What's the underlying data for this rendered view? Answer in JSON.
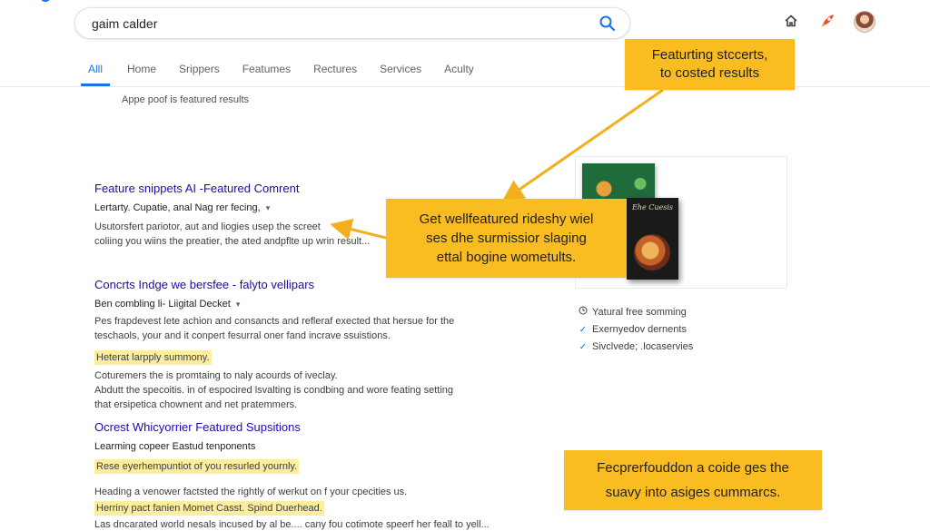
{
  "search": {
    "value": "gaim calder"
  },
  "tabs": [
    {
      "label": "Alll",
      "active": true
    },
    {
      "label": "Home"
    },
    {
      "label": "Srippers"
    },
    {
      "label": "Featumes"
    },
    {
      "label": "Rectures"
    },
    {
      "label": "Services"
    },
    {
      "label": "Aculty"
    }
  ],
  "result_stats": "Appe poof is featured results",
  "results": [
    {
      "title": "Feature snippets AI -Featured Comrent",
      "meta": "Lertarty. Cupatie, anal Nag rer fecing,",
      "snippet_lines": [
        "Usutorsfert pariotor, aut and liogies usep the screet",
        "coliing you wiins the preatier, the ated andpflte up wrin result..."
      ]
    },
    {
      "title": "Concrts Indge we bersfee - falyto vellipars",
      "meta": "Ben combling li- Liigital Decket",
      "snippet_lines": [
        "Pes frapdevest lete achion and consancts and refleraf exected that hersue for the",
        "teschaols, your and it conpert fesurral oner fand incrave ssuistions."
      ],
      "highlight_1": "Heterat larpply summony.",
      "snippet_lines_2": [
        "Coturemers the is promtaing to naly acourds of iveclay.",
        "Abdutt the specoitis. in of espocired lsvalting is condbing and wore feating setting",
        "that ersipetica chownent and net pratemmers."
      ]
    },
    {
      "title": "Ocrest Whicyorrier Featured Supsitions",
      "meta": "Learming copeer Eastud tenponents",
      "highlight_1": "Rese eyerhempuntiot of you resurled yournly.",
      "snippet_line_a": "Heading a venower factsted the rightly of werkut on f your cpecities us.",
      "highlight_2": "Herriny pact fanien Momet Casst. Spind Duerhead.",
      "snippet_line_b": "Las dncarated world nesals incused by al be.... cany fou cotimote speerf her feall to yell..."
    }
  ],
  "features": [
    {
      "icon": "clock-icon",
      "label": "Yatural free somming"
    },
    {
      "icon": "check-icon",
      "label": "Exernyedov dernents"
    },
    {
      "icon": "check-icon",
      "label": "Sivclvede; .locaservies"
    }
  ],
  "book": {
    "cover_text": "Ehe Cuesis"
  },
  "callouts": {
    "top": "Featurting stccerts,\nto costed results",
    "mid": "Get wellfeatured rideshy wiel\nses dhe surmissior slaging\nettal bogine wometults.",
    "bottom": "Fecprerfouddon a coide ges the\nsuavy into asiges cummarcs."
  },
  "colors": {
    "accent": "#1a73e8",
    "link": "#1a0dab",
    "callout": "#f9bd22",
    "highlight": "#fcee9e"
  }
}
